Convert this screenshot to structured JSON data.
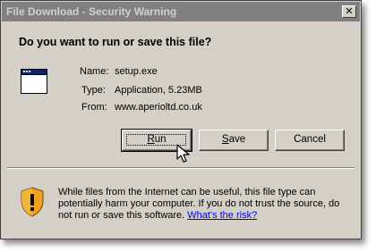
{
  "window": {
    "title": "File Download - Security Warning",
    "close_glyph": "✕"
  },
  "prompt": {
    "question": "Do you want to run or save this file?"
  },
  "file": {
    "icon": "application-window-icon",
    "name_label": "Name:",
    "name": "setup.exe",
    "type_label": "Type:",
    "type": "Application, 5.23MB",
    "from_label": "From:",
    "from": "www.aperioltd.co.uk"
  },
  "buttons": {
    "run_prefix": "",
    "run_accel": "R",
    "run_rest": "un",
    "save_prefix": "",
    "save_accel": "S",
    "save_rest": "ave",
    "cancel": "Cancel"
  },
  "warning": {
    "icon": "security-shield-icon",
    "text": "While files from the Internet can be useful, this file type can potentially harm your computer. If you do not trust the source, do not run or save this software. ",
    "link": "What's the risk?"
  },
  "colors": {
    "dialog_face": "#d4d0c8",
    "titlebar_inactive": "#808080",
    "link": "#0000ee",
    "shield_orange": "#f0a020"
  }
}
